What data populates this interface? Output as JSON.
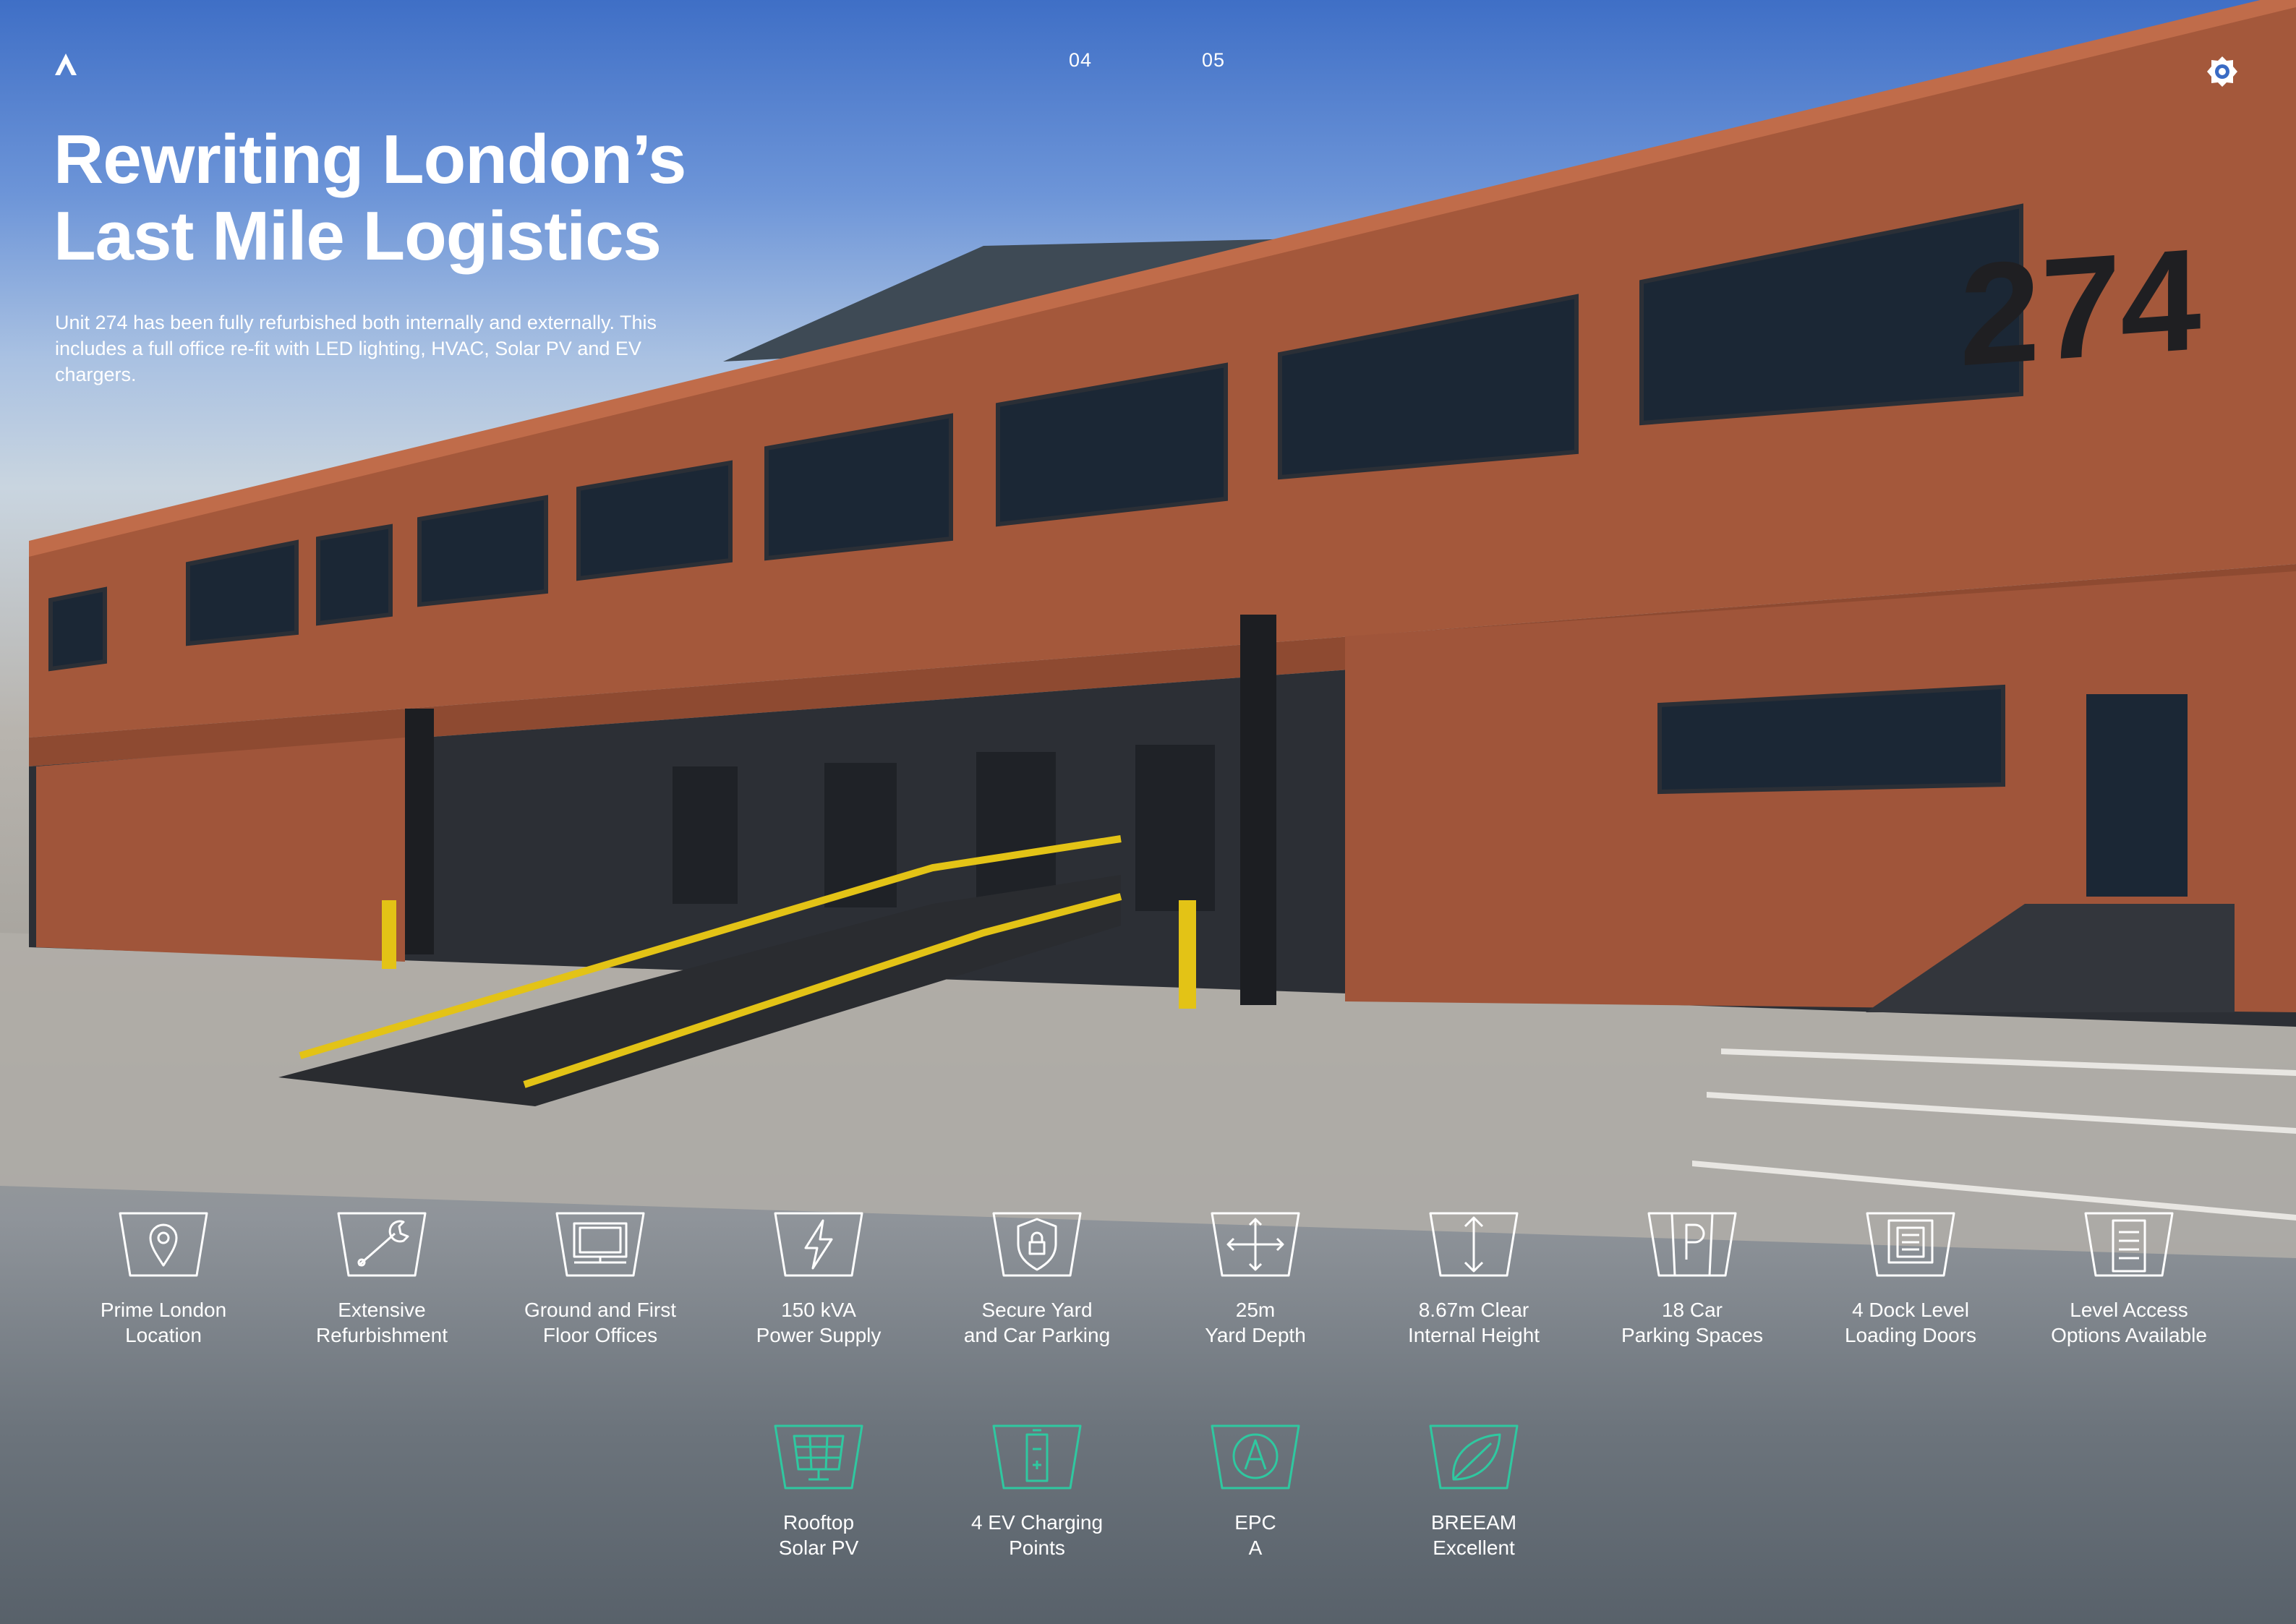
{
  "colors": {
    "accent_green": "#2fc8a0",
    "text": "#ffffff",
    "brick": "#a0553a"
  },
  "header": {
    "page_left": "04",
    "page_right": "05",
    "logo_icon": "arrow-logo-icon",
    "badge_icon": "hexagon-badge-icon"
  },
  "photo": {
    "building_number": "274"
  },
  "title": {
    "line1": "Rewriting London’s",
    "line2": "Last Mile Logistics"
  },
  "intro": "Unit 274 has been fully refurbished both internally and externally. This includes a full office re-fit with LED lighting, HVAC, Solar PV and EV chargers.",
  "features": [
    {
      "icon": "location-pin-icon",
      "line1": "Prime London",
      "line2": "Location"
    },
    {
      "icon": "wrench-icon",
      "line1": "Extensive",
      "line2": "Refurbishment"
    },
    {
      "icon": "monitor-desk-icon",
      "line1": "Ground and First",
      "line2": "Floor Offices"
    },
    {
      "icon": "lightning-icon",
      "line1": "150 kVA",
      "line2": "Power Supply"
    },
    {
      "icon": "shield-lock-icon",
      "line1": "Secure Yard",
      "line2": "and Car Parking"
    },
    {
      "icon": "arrows-cross-icon",
      "line1": "25m",
      "line2": "Yard Depth"
    },
    {
      "icon": "arrow-vertical-icon",
      "line1": "8.67m Clear",
      "line2": "Internal Height"
    },
    {
      "icon": "parking-icon",
      "line1": "18 Car",
      "line2": "Parking Spaces"
    },
    {
      "icon": "dock-door-icon",
      "line1": "4 Dock Level",
      "line2": "Loading Doors"
    },
    {
      "icon": "level-door-icon",
      "line1": "Level Access",
      "line2": "Options Available"
    }
  ],
  "green_features": [
    {
      "icon": "solar-panel-icon",
      "line1": "Rooftop",
      "line2": "Solar PV"
    },
    {
      "icon": "ev-charger-icon",
      "line1": "4 EV Charging",
      "line2": "Points"
    },
    {
      "icon": "epc-a-icon",
      "line1": "EPC",
      "line2": "A"
    },
    {
      "icon": "leaf-icon",
      "line1": "BREEAM",
      "line2": "Excellent"
    }
  ]
}
